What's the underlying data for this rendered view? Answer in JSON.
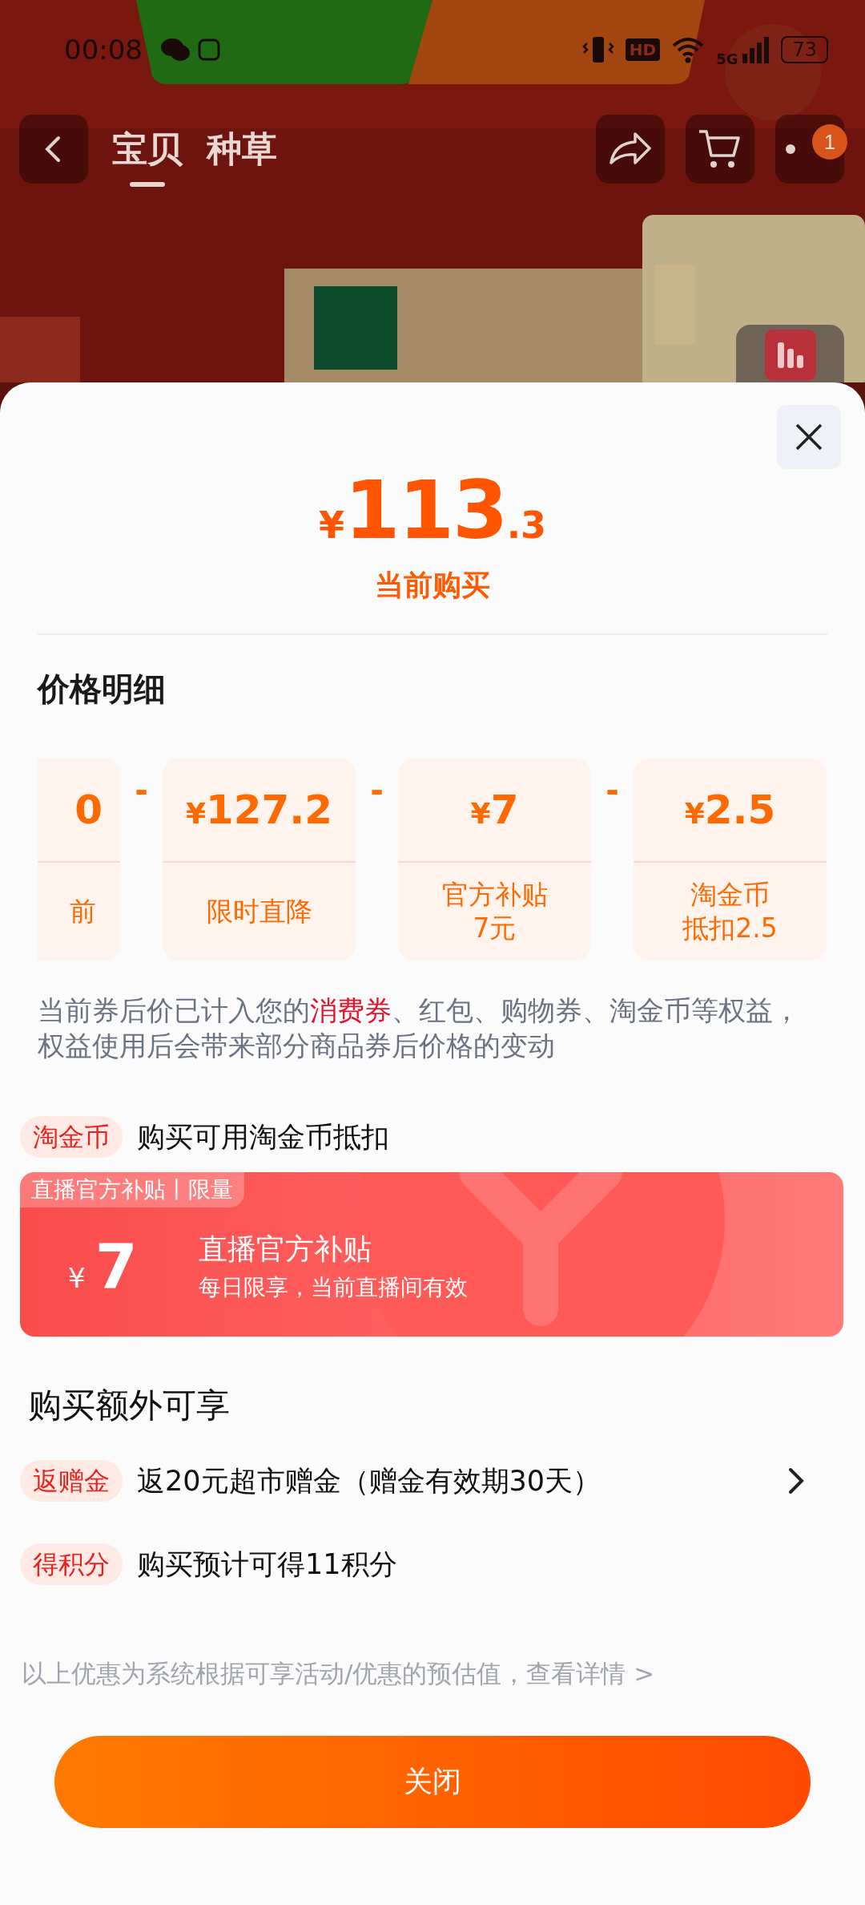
{
  "status_bar": {
    "time": "00:08",
    "hd": "HD",
    "network": "5G",
    "battery": "73"
  },
  "nav": {
    "tabs": [
      {
        "label": "宝贝",
        "selected": true
      },
      {
        "label": "种草",
        "selected": false
      }
    ],
    "more_badge": "1"
  },
  "sheet": {
    "price": {
      "currency": "¥",
      "integer": "113",
      "decimal": ".3",
      "caption": "当前购买"
    },
    "breakdown_title": "价格明细",
    "breakdown": [
      {
        "kind": "partial",
        "amount": "0",
        "lines": [
          "前"
        ]
      },
      {
        "kind": "full",
        "operator": "-",
        "currency": "¥",
        "amount": "127.2",
        "lines": [
          "限时直降"
        ]
      },
      {
        "kind": "full",
        "operator": "-",
        "currency": "¥",
        "amount": "7",
        "lines": [
          "官方补贴",
          "7元"
        ]
      },
      {
        "kind": "full",
        "operator": "-",
        "currency": "¥",
        "amount": "2.5",
        "lines": [
          "淘金币",
          "抵扣2.5"
        ]
      }
    ],
    "note": [
      {
        "text": "当前券后价已计入您的",
        "highlight": false
      },
      {
        "text": "消费券",
        "highlight": true
      },
      {
        "text": "、红包、购物券、淘金币等权益，权益使用后会带来部分商品券后价格的变动",
        "highlight": false
      }
    ],
    "coin": {
      "badge": "淘金币",
      "text": "购买可用淘金币抵扣"
    },
    "subsidy": {
      "tag": "直播官方补贴丨限量",
      "currency": "¥",
      "amount": "7",
      "title": "直播官方补贴",
      "subtitle": "每日限享，当前直播间有效"
    },
    "extras_title": "购买额外可享",
    "extras": [
      {
        "badge": "返赠金",
        "text": "返20元超市赠金（赠金有效期30天）",
        "has_arrow": true
      },
      {
        "badge": "得积分",
        "text": "购买预计可得11积分",
        "has_arrow": false
      }
    ],
    "footer_note": "以上优惠为系统根据可享活动/优惠的预估值，",
    "footer_link": "查看详情 >",
    "close_button": "关闭"
  }
}
